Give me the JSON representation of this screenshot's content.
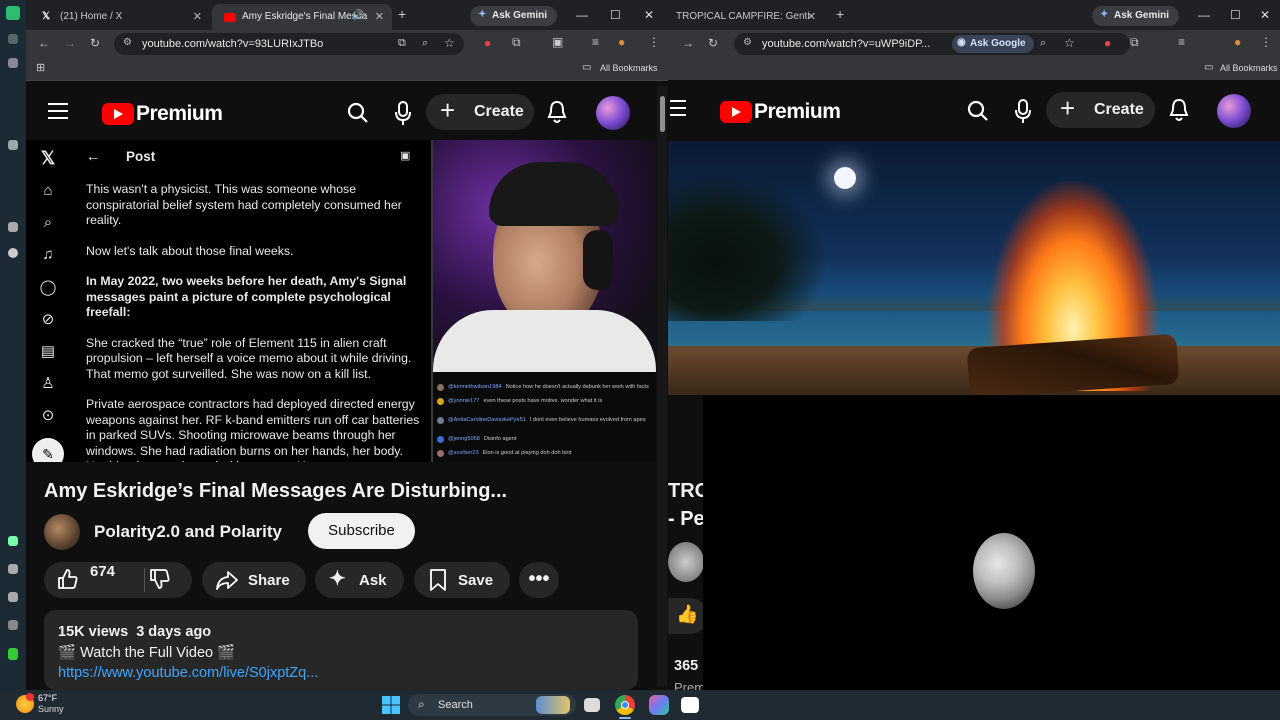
{
  "left_window": {
    "tabs": [
      {
        "label": "(21) Home / X"
      },
      {
        "label": "Amy Eskridge's Final Messa"
      }
    ],
    "gemini_label": "Ask Gemini",
    "url": "youtube.com/watch?v=93LURIxJTBo",
    "bookmarks_label": "All Bookmarks"
  },
  "right_window": {
    "tabs": [
      {
        "label": "TROPICAL CAMPFIRE: Genti"
      }
    ],
    "gemini_label": "Ask Gemini",
    "url": "youtube.com/watch?v=uWP9iDP...",
    "ask_google_label": "Ask Google",
    "bookmarks_label": "All Bookmarks",
    "title_fragment_1": "TRO",
    "title_fragment_2": "- Pe",
    "like_count_fragment": "365",
    "desc_fragment": "Prem"
  },
  "youtube": {
    "logo_text": "Premium",
    "create_label": "Create"
  },
  "video_left": {
    "x_post": {
      "header": "Post",
      "paragraphs": [
        {
          "text": "This wasn't a physicist. This was someone whose conspiratorial belief system had completely consumed her reality.",
          "bold": false
        },
        {
          "text": "Now let's talk about those final weeks.",
          "bold": false
        },
        {
          "text": "In May 2022, two weeks before her death, Amy's Signal messages paint a picture of complete psychological freefall:",
          "bold": true
        },
        {
          "text": "She cracked the “true” role of Element 115 in alien craft propulsion – left herself a voice memo about it while driving. That memo got surveilled. She was now on a kill list.",
          "bold": false
        },
        {
          "text": "Private aerospace contractors had deployed directed energy weapons against her. RF k-band emitters run off car batteries in parked SUVs. Shooting microwave beams through her windows. She had radiation burns on her hands, her body. Her blood was poisoned with mercury. Her cat was",
          "bold": false
        }
      ]
    },
    "chat": [
      {
        "name": "@kennethwilson1984",
        "msg": "Notice how he doesn't actually debunk her work with facts",
        "color": "#8a6f5a"
      },
      {
        "name": "@yonnie177",
        "msg": "even these posts have motive. wonder what it is",
        "color": "#d9a521"
      },
      {
        "name": "@AnitaCarolineDavisskePye51",
        "msg": "I dont even believe humans evolved from apes",
        "color": "#6f7d8a"
      },
      {
        "name": "@jenng5068",
        "msg": "Disinfo agent",
        "color": "#3d6fd8"
      },
      {
        "name": "@scorber23",
        "msg": "Elon is good at playing doh doh bird",
        "color": "#9a6f6f"
      }
    ]
  },
  "video_info": {
    "title": "Amy Eskridge’s Final Messages Are Disturbing...",
    "channel_name": "Polarity2.0 and Polarity",
    "subscribe_label": "Subscribe",
    "like_count": "674",
    "share_label": "Share",
    "ask_label": "Ask",
    "save_label": "Save",
    "views": "15K views",
    "age": "3 days ago",
    "desc_line": "🎬 Watch the Full Video 🎬",
    "desc_link": "https://www.youtube.com/live/S0jxptZq..."
  },
  "taskbar": {
    "weather_temp": "67°F",
    "weather_desc": "Sunny",
    "search_label": "Search"
  },
  "colors": {
    "yt_red": "#ff0000",
    "link_blue": "#3ea6ff",
    "pill_bg": "#272727"
  }
}
